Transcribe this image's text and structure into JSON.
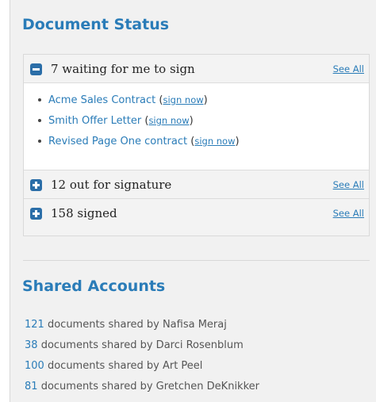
{
  "document_status": {
    "title": "Document Status",
    "waiting": {
      "label": "7 waiting for me to sign",
      "see_all": "See All",
      "documents": [
        {
          "name": "Acme Sales Contract",
          "action": "sign now"
        },
        {
          "name": "Smith Offer Letter",
          "action": "sign now"
        },
        {
          "name": "Revised Page One contract",
          "action": "sign now"
        }
      ]
    },
    "out_for_signature": {
      "label": "12 out for signature",
      "see_all": "See All"
    },
    "signed": {
      "label": "158 signed",
      "see_all": "See All"
    }
  },
  "shared_accounts": {
    "title": "Shared Accounts",
    "items": [
      {
        "count": "121",
        "text": "documents shared by Nafisa Meraj"
      },
      {
        "count": "38",
        "text": "documents shared by Darci Rosenblum"
      },
      {
        "count": "100",
        "text": "documents shared by Art Peel"
      },
      {
        "count": "81",
        "text": "documents shared by Gretchen DeKnikker"
      }
    ]
  },
  "colors": {
    "accent": "#2a7cb8",
    "panel_background": "#f1f1f1",
    "icon": "#2b6ea8"
  },
  "icons": {
    "collapse": "minus-square-icon",
    "expand": "plus-square-icon"
  }
}
